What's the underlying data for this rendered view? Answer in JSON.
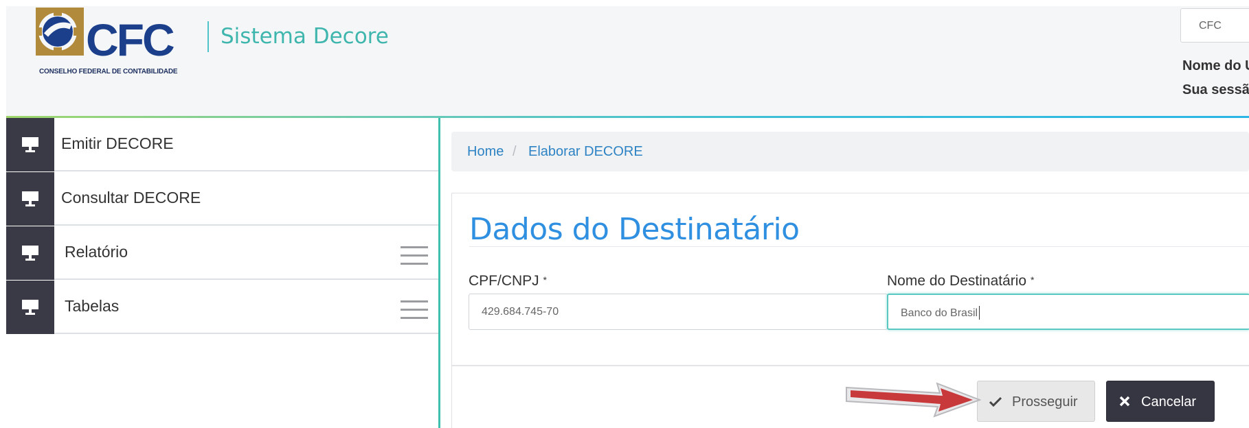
{
  "header": {
    "logo_text": "CFC",
    "logo_subtitle": "CONSELHO FEDERAL DE CONTABILIDADE",
    "app_title": "Sistema Decore",
    "org_select_value": "CFC",
    "user_line_1": "Nome do U",
    "user_line_2": "Sua sessão"
  },
  "sidebar": {
    "items": [
      {
        "label": "Emitir DECORE",
        "icon": "monitor-icon",
        "has_menu": false
      },
      {
        "label": "Consultar DECORE",
        "icon": "monitor-icon",
        "has_menu": false
      },
      {
        "label": "Relatório",
        "icon": "monitor-icon",
        "has_menu": true
      },
      {
        "label": "Tabelas",
        "icon": "monitor-icon",
        "has_menu": true
      }
    ]
  },
  "breadcrumb": {
    "items": [
      "Home",
      "Elaborar DECORE"
    ],
    "separator": "/"
  },
  "form": {
    "title": "Dados do Destinatário",
    "fields": [
      {
        "label": "CPF/CNPJ",
        "required_mark": "*",
        "value": "429.684.745-70"
      },
      {
        "label": "Nome do Destinatário",
        "required_mark": "*",
        "value": "Banco do Brasil"
      }
    ],
    "buttons": {
      "continue_label": "Prosseguir",
      "cancel_label": "Cancelar"
    }
  },
  "colors": {
    "accent_teal": "#3fb6ad",
    "title_blue": "#2f8fe0",
    "sidebar_dark": "#3a3a47",
    "link_blue": "#2d83c3",
    "annotation_arrow": "#c8393b"
  }
}
